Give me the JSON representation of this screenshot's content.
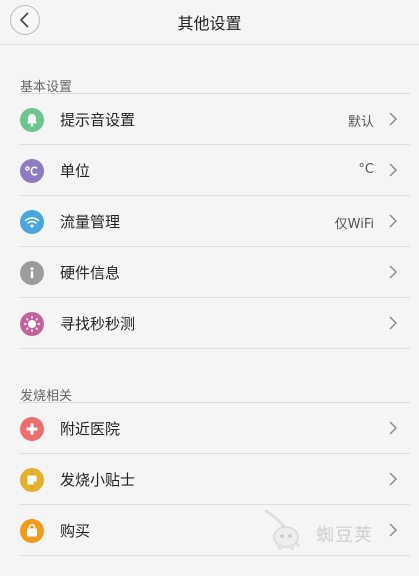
{
  "header": {
    "title": "其他设置",
    "back_icon": "back-chevron-icon"
  },
  "sections": [
    {
      "title": "基本设置",
      "items": [
        {
          "label": "提示音设置",
          "value": "默认",
          "icon": "bell-icon",
          "color": "#6cc58f"
        },
        {
          "label": "单位",
          "value": "°C",
          "icon": "celsius-icon",
          "color": "#8e7bc3"
        },
        {
          "label": "流量管理",
          "value": "仅WiFi",
          "icon": "wifi-icon",
          "color": "#4ba7d9"
        },
        {
          "label": "硬件信息",
          "value": "",
          "icon": "info-icon",
          "color": "#9c9c9c"
        },
        {
          "label": "寻找秒秒测",
          "value": "",
          "icon": "sun-icon",
          "color": "#c2629a"
        }
      ]
    },
    {
      "title": "发烧相关",
      "items": [
        {
          "label": "附近医院",
          "value": "",
          "icon": "hospital-cross-icon",
          "color": "#eb6f6f"
        },
        {
          "label": "发烧小贴士",
          "value": "",
          "icon": "note-icon",
          "color": "#e5b02f"
        },
        {
          "label": "购买",
          "value": "",
          "icon": "shopping-bag-icon",
          "color": "#f29a1a"
        }
      ]
    }
  ],
  "watermark": {
    "text": "蜘豆荚",
    "icon": "bean-mascot-logo"
  }
}
